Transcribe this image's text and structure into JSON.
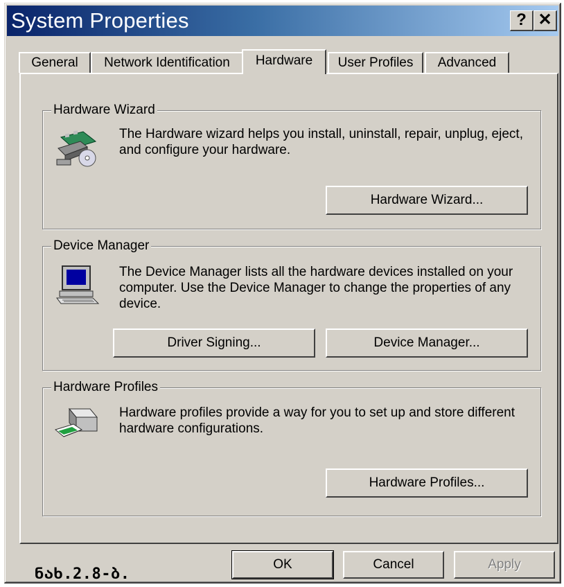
{
  "window": {
    "title": "System Properties"
  },
  "titlebar_buttons": {
    "help_label": "?",
    "close_label": "✕"
  },
  "tabs": [
    {
      "label": "General"
    },
    {
      "label": "Network Identification"
    },
    {
      "label": "Hardware",
      "active": true
    },
    {
      "label": "User Profiles"
    },
    {
      "label": "Advanced"
    }
  ],
  "groups": {
    "hardware_wizard": {
      "title": "Hardware Wizard",
      "text": "The Hardware wizard helps you install, uninstall, repair, unplug, eject, and configure your hardware.",
      "button": "Hardware Wizard...",
      "icon": "hardware-wizard-icon"
    },
    "device_manager": {
      "title": "Device Manager",
      "text": "The Device Manager lists all the hardware devices installed on your computer. Use the Device Manager to change the properties of any device.",
      "button_driver_signing": "Driver Signing...",
      "button_device_manager": "Device Manager...",
      "icon": "computer-icon"
    },
    "hardware_profiles": {
      "title": "Hardware Profiles",
      "text": "Hardware profiles provide a way for you to set up and store different hardware configurations.",
      "button": "Hardware Profiles...",
      "icon": "hardware-profile-icon"
    }
  },
  "footer": {
    "ok": "OK",
    "cancel": "Cancel",
    "apply": "Apply"
  },
  "caption": "ნახ.2.8-ბ.",
  "colors": {
    "title_start": "#0a246a",
    "title_end": "#a6caf0",
    "face": "#d4d0c8"
  }
}
